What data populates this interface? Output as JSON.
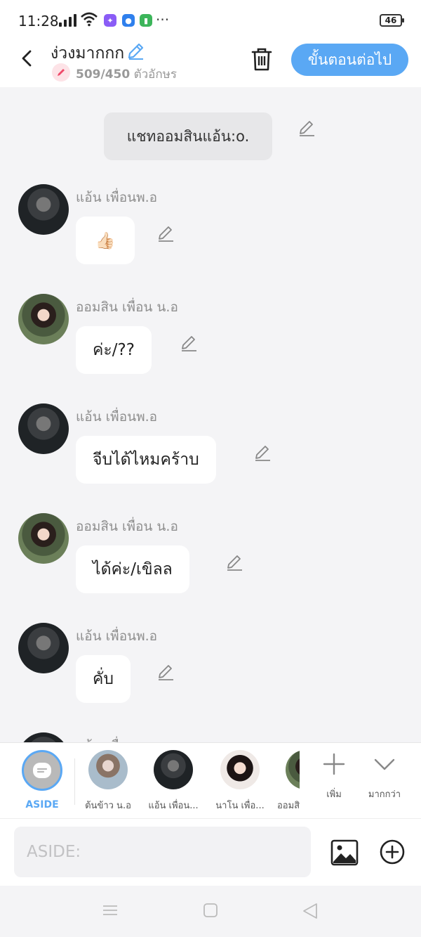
{
  "status_bar": {
    "time": "11:28",
    "battery": "46"
  },
  "header": {
    "title": "ง่วงมากกก",
    "char_count": "509/450",
    "char_unit": "ตัวอักษร",
    "next_label": "ขั้นตอนต่อไป"
  },
  "chat": {
    "aside_text": "แชทออมสินแอ้น:o.",
    "messages": [
      {
        "sender": "แอ้น เพื่อนพ.อ",
        "text": "👍🏻",
        "avatar": "boy"
      },
      {
        "sender": "ออมสิน เพื่อน น.อ",
        "text": "ค่ะ/??",
        "avatar": "girl"
      },
      {
        "sender": "แอ้น เพื่อนพ.อ",
        "text": "จีบได้ไหมคร้าบ",
        "avatar": "boy"
      },
      {
        "sender": "ออมสิน เพื่อน น.อ",
        "text": "ได้ค่ะ/เขิลล",
        "avatar": "girl"
      },
      {
        "sender": "แอ้น เพื่อนพ.อ",
        "text": "คั่บ",
        "avatar": "boy"
      },
      {
        "sender": "แอ้น เพื่อนพ.อ",
        "text": "",
        "avatar": "boy"
      }
    ]
  },
  "characters": {
    "aside_label": "ASIDE",
    "items": [
      {
        "label": "ต้นข้าว น.อ"
      },
      {
        "label": "แอ้น เพื่อน..."
      },
      {
        "label": "นาโน เพื่อ..."
      },
      {
        "label": "ออมสิ"
      }
    ],
    "add_label": "เพิ่ม",
    "more_label": "มากกว่า"
  },
  "input": {
    "placeholder": "ASIDE:"
  },
  "colors": {
    "accent": "#5aa8f4",
    "bubble": "#ffffff",
    "background": "#f4f4f6"
  }
}
